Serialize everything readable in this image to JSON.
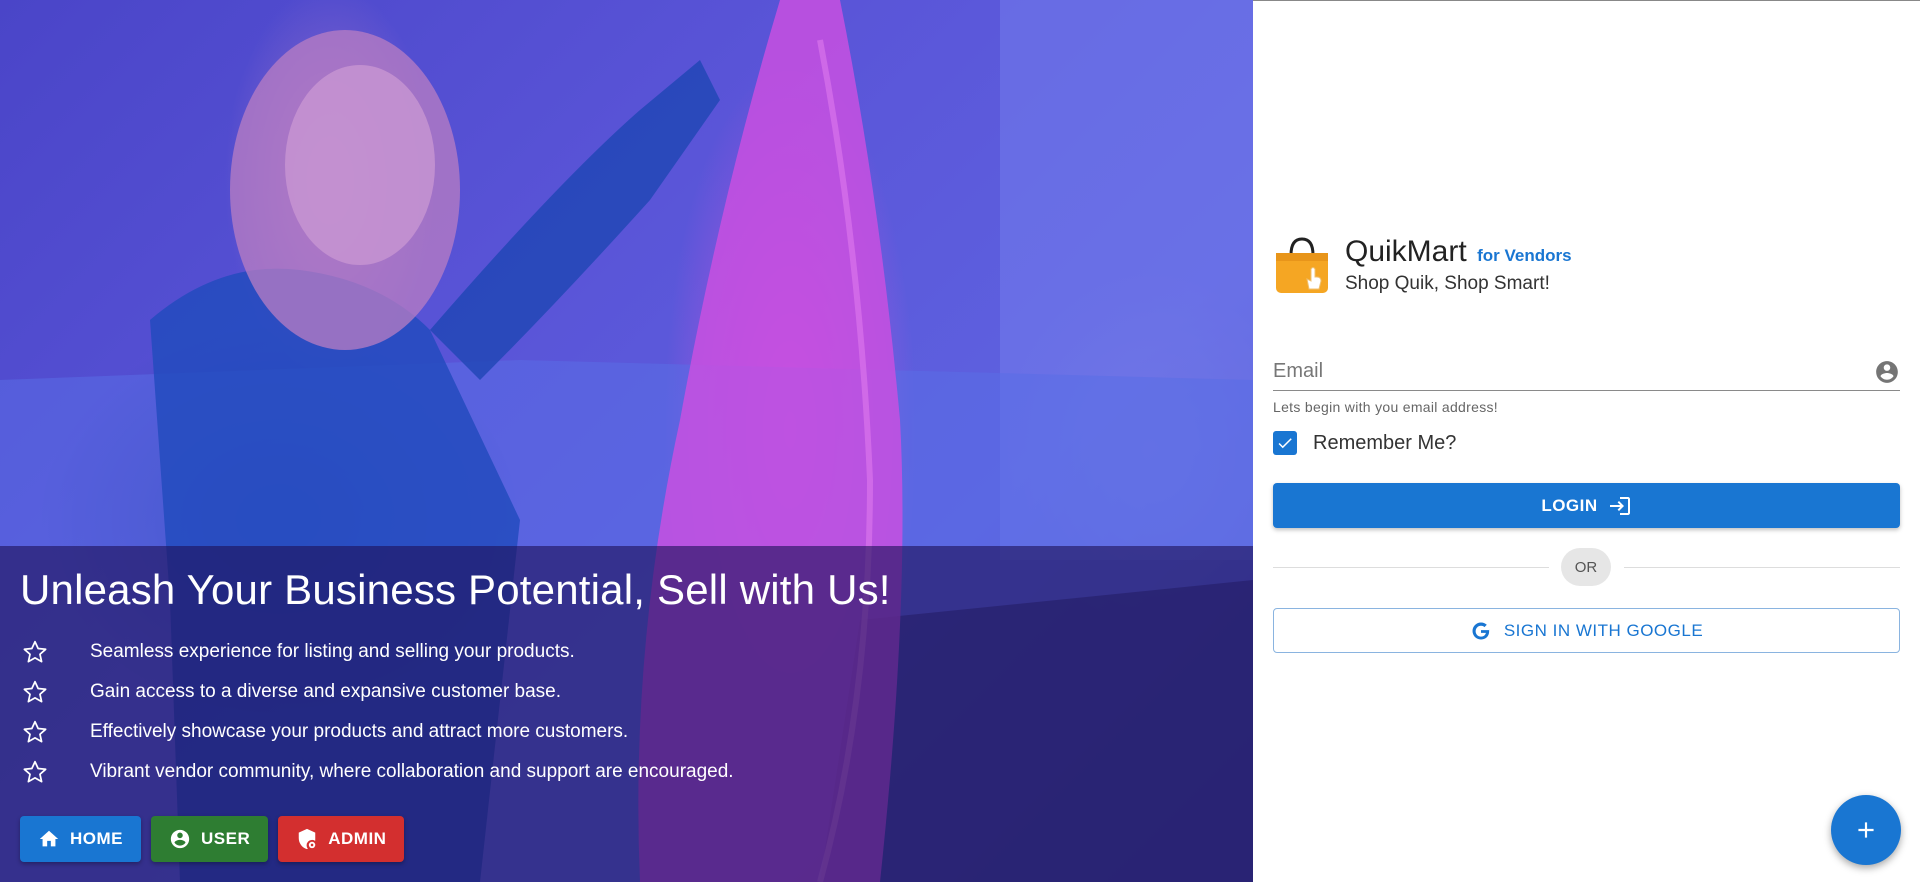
{
  "hero": {
    "title": "Unleash Your Business Potential, Sell with Us!",
    "features": [
      "Seamless experience for listing and selling your products.",
      "Gain access to a diverse and expansive customer base.",
      "Effectively showcase your products and attract more customers.",
      "Vibrant vendor community, where collaboration and support are encouraged."
    ],
    "buttons": {
      "home": "HOME",
      "user": "USER",
      "admin": "ADMIN"
    }
  },
  "brand": {
    "name": "QuikMart",
    "vendor": "for Vendors",
    "tagline": "Shop Quik, Shop Smart!"
  },
  "login": {
    "email_placeholder": "Email",
    "email_hint": "Lets begin with you email address!",
    "remember_label": "Remember Me?",
    "remember_checked": true,
    "login_label": "LOGIN",
    "or_label": "OR",
    "google_label": "SIGN IN WITH GOOGLE"
  },
  "colors": {
    "primary": "#1976d2",
    "success": "#2e7d32",
    "danger": "#d32f2f",
    "logo_bag": "#f5a623"
  },
  "icons": {
    "feature": "star-outline-icon",
    "home": "home-icon",
    "user": "account-circle-icon",
    "admin": "admin-shield-icon",
    "email": "account-circle-icon",
    "login": "login-icon",
    "google": "google-icon",
    "fab": "plus-icon"
  }
}
